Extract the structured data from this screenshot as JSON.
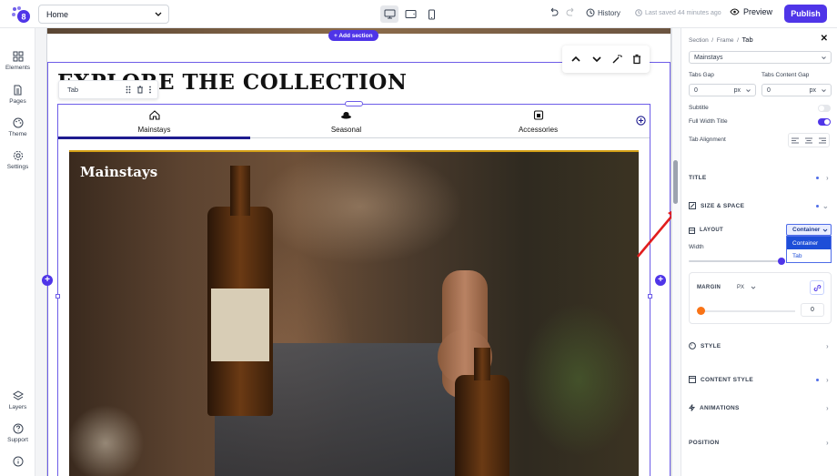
{
  "topbar": {
    "page_select": "Home",
    "history_label": "History",
    "saved_label": "Last saved 44 minutes ago",
    "preview_label": "Preview",
    "publish_label": "Publish"
  },
  "sidebar": {
    "items": [
      {
        "label": "Elements"
      },
      {
        "label": "Pages"
      },
      {
        "label": "Theme"
      },
      {
        "label": "Settings"
      },
      {
        "label": "Layers"
      },
      {
        "label": "Support"
      }
    ]
  },
  "canvas": {
    "add_section_label": "+ Add section",
    "heading": "EXPLORE THE COLLECTION",
    "tab_chip_label": "Tab",
    "tabs": [
      {
        "label": "Mainstays",
        "icon": "home-icon"
      },
      {
        "label": "Seasonal",
        "icon": "hat-icon"
      },
      {
        "label": "Accessories",
        "icon": "box-icon"
      }
    ],
    "panel_title": "Mainstays"
  },
  "panel": {
    "breadcrumb": [
      "Section",
      "Frame",
      "Tab"
    ],
    "tab_select": "Mainstays",
    "tabs_gap_label": "Tabs Gap",
    "tabs_gap_value": "0",
    "tabs_gap_unit": "px",
    "tabs_content_gap_label": "Tabs Content Gap",
    "tabs_content_gap_value": "0",
    "tabs_content_gap_unit": "px",
    "subtitle_label": "Subtitle",
    "subtitle_on": false,
    "full_width_title_label": "Full Width Title",
    "full_width_title_on": true,
    "tab_alignment_label": "Tab Alignment",
    "sections": {
      "title": "TITLE",
      "size_space": "SIZE & SPACE",
      "layout": "LAYOUT",
      "style": "STYLE",
      "content_style": "CONTENT STYLE",
      "animations": "ANIMATIONS",
      "position": "POSITION"
    },
    "layout_value": "Container",
    "layout_options": [
      "Container",
      "Tab"
    ],
    "width_label": "Width",
    "margin_label": "MARGIN",
    "margin_unit": "PX",
    "margin_value": "0"
  },
  "colors": {
    "accent": "#4f35e8",
    "tab_active": "#1e1b8f",
    "arrow": "#e11d1d"
  }
}
